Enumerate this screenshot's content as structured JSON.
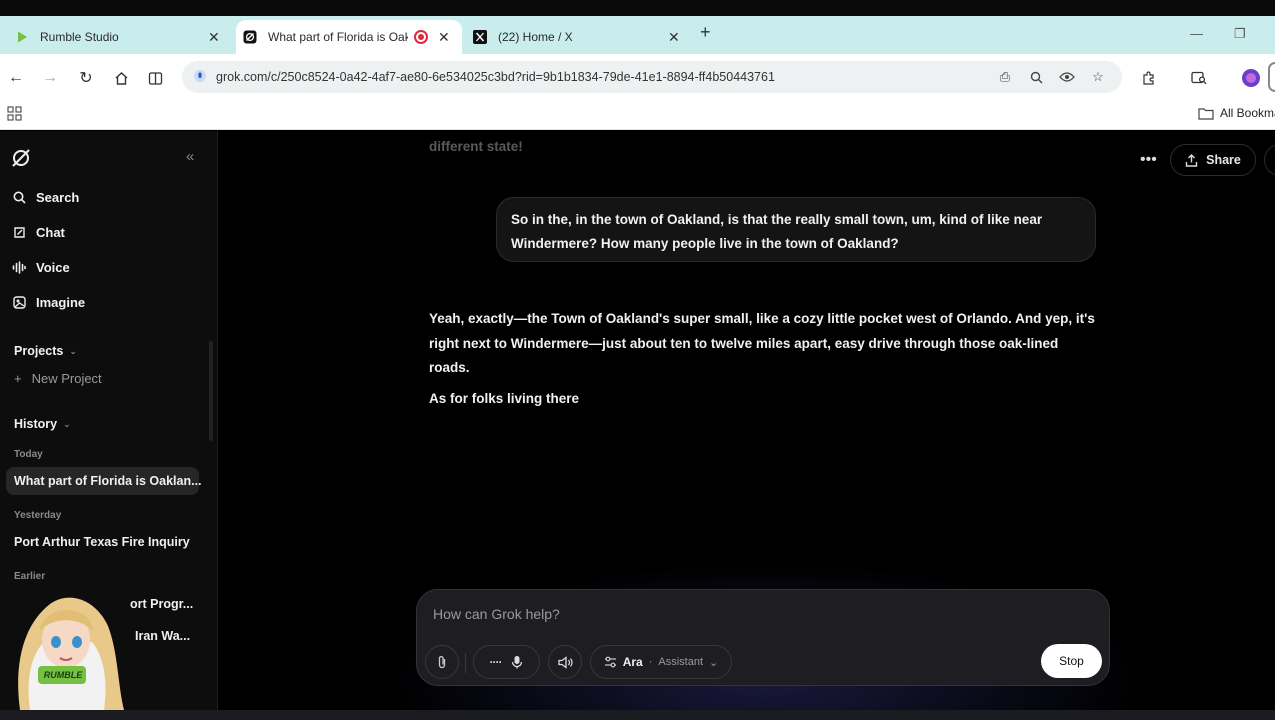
{
  "browser": {
    "tabs": [
      {
        "title": "Rumble Studio",
        "icon": "rumble-icon"
      },
      {
        "title": "What part of Florida is Oakl",
        "icon": "grok-icon",
        "recording": true,
        "active": true
      },
      {
        "title": "(22) Home / X",
        "icon": "x-icon"
      }
    ],
    "url": "grok.com/c/250c8524-0a42-4af7-ae80-6e534025c3bd?rid=9b1b1834-79de-41e1-8894-ff4b50443761",
    "bookmarks_label": "All Bookma"
  },
  "sidebar": {
    "nav": [
      {
        "label": "Search",
        "icon": "search-icon"
      },
      {
        "label": "Chat",
        "icon": "chat-icon"
      },
      {
        "label": "Voice",
        "icon": "voice-icon"
      },
      {
        "label": "Imagine",
        "icon": "imagine-icon"
      }
    ],
    "projects_label": "Projects",
    "new_project_label": "New Project",
    "history_label": "History",
    "today_label": "Today",
    "today_items": [
      "What part of Florida is Oaklan..."
    ],
    "yesterday_label": "Yesterday",
    "yesterday_items": [
      "Port Arthur Texas Fire Inquiry"
    ],
    "earlier_label": "Earlier",
    "earlier_items": [
      "ort Progr...",
      "Iran Wa..."
    ],
    "avatar_shirt_text": "RUMBLE"
  },
  "main": {
    "share_label": "Share",
    "faded_previous": "different state!",
    "user_message": "So in the, in the town of Oakland, is that the really small town, um, kind of like near Windermere? How many people live in the town of Oakland?",
    "reply_paragraphs": [
      "Yeah, exactly—the Town of Oakland's super small, like a cozy little pocket west of Orlando. And yep, it's right next to Windermere—just about ten to twelve miles apart, easy drive through those oak-lined roads.",
      "As for folks living there"
    ]
  },
  "composer": {
    "placeholder": "How can Grok help?",
    "model_name": "Ara",
    "model_mode": "Assistant",
    "stop_label": "Stop"
  },
  "colors": {
    "tab_bar": "#c9ecec",
    "app_bg": "#000000",
    "sidebar_bg": "#0d0d0d",
    "rumble_green": "#75c043"
  }
}
